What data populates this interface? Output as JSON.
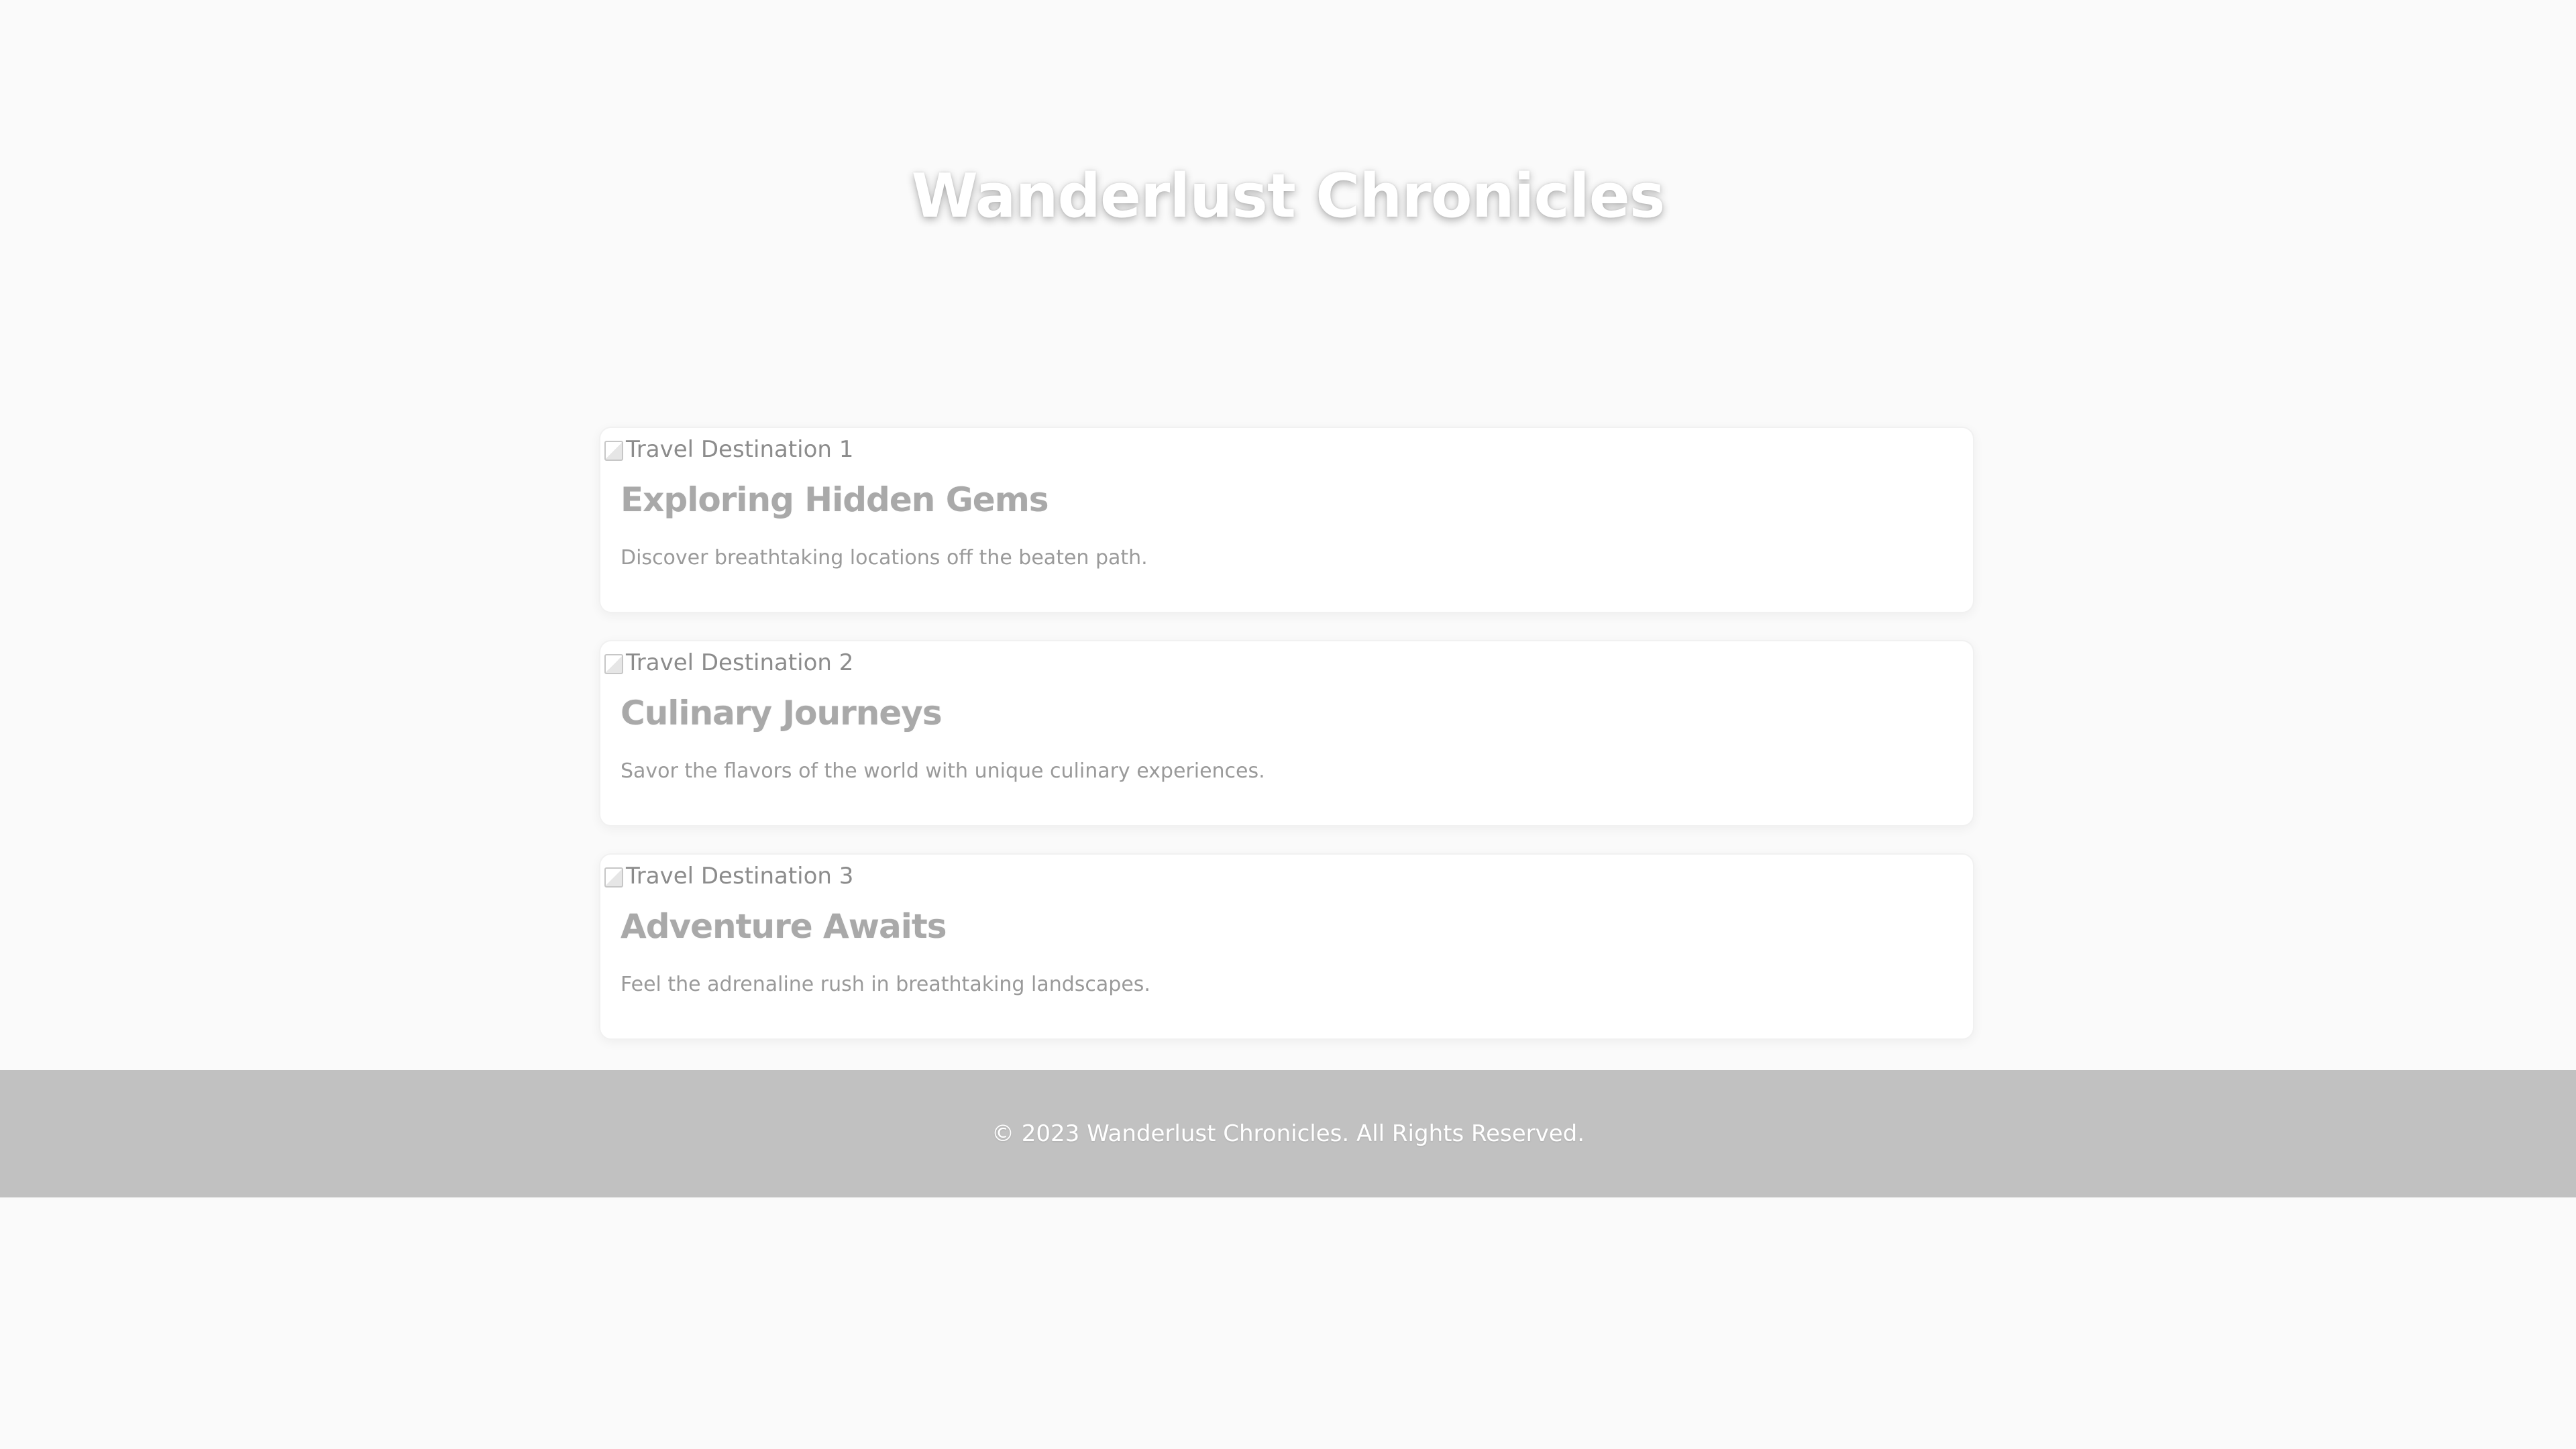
{
  "header": {
    "title": "Wanderlust Chronicles"
  },
  "posts": [
    {
      "image_alt": "Travel Destination 1",
      "title": "Exploring Hidden Gems",
      "description": "Discover breathtaking locations off the beaten path."
    },
    {
      "image_alt": "Travel Destination 2",
      "title": "Culinary Journeys",
      "description": "Savor the flavors of the world with unique culinary experiences."
    },
    {
      "image_alt": "Travel Destination 3",
      "title": "Adventure Awaits",
      "description": "Feel the adrenaline rush in breathtaking landscapes."
    }
  ],
  "footer": {
    "copyright": "© 2023 Wanderlust Chronicles. All Rights Reserved."
  },
  "colors": {
    "page_background": "#fafafa",
    "card_background": "#ffffff",
    "footer_background": "#c1c1c1",
    "title_text": "#ffffff",
    "post_title_text": "#a9a9a9"
  }
}
